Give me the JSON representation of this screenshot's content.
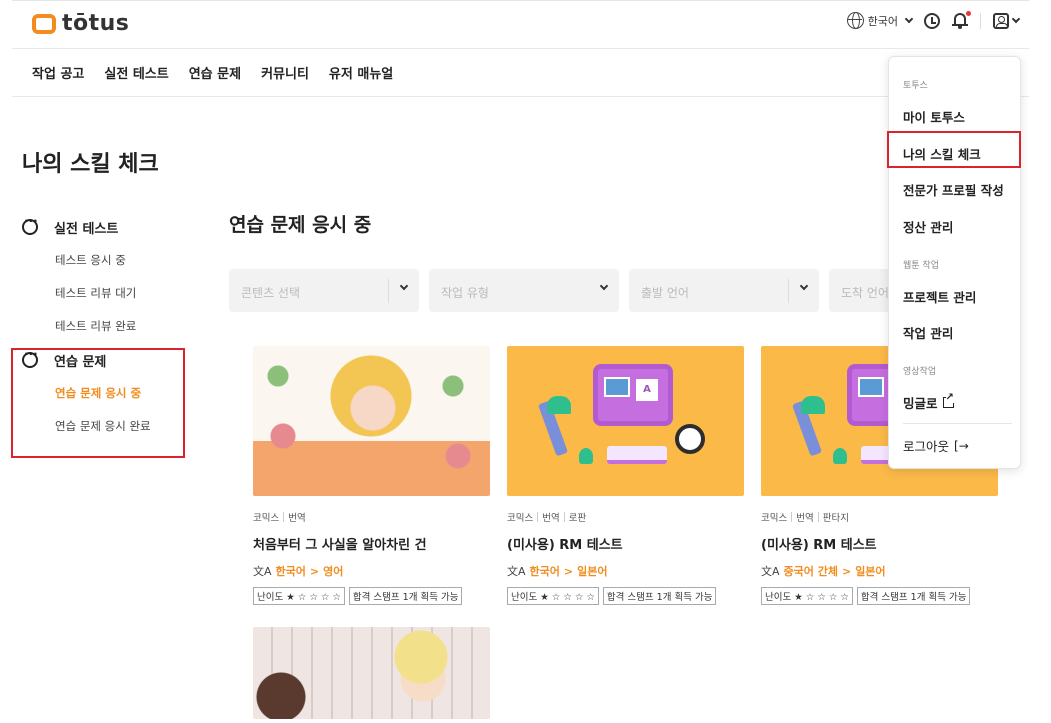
{
  "header": {
    "brand": "tōtus",
    "language": "한국어"
  },
  "nav": [
    "작업 공고",
    "실전 테스트",
    "연습 문제",
    "커뮤니티",
    "유저 매뉴얼"
  ],
  "page_title": "나의 스킬 체크",
  "sidebar": {
    "sections": [
      {
        "title": "실전 테스트",
        "items": [
          {
            "label": "테스트 응시 중",
            "active": false
          },
          {
            "label": "테스트 리뷰 대기",
            "active": false
          },
          {
            "label": "테스트 리뷰 완료",
            "active": false
          }
        ]
      },
      {
        "title": "연습 문제",
        "items": [
          {
            "label": "연습 문제 응시 중",
            "active": true
          },
          {
            "label": "연습 문제 응시 완료",
            "active": false
          }
        ]
      }
    ]
  },
  "content_title": "연습 문제 응시 중",
  "filters": [
    "콘텐츠 선택",
    "작업 유형",
    "출발 언어",
    "도착 언어"
  ],
  "cards": [
    {
      "tags": [
        "코믹스",
        "번역"
      ],
      "title": "처음부터 그 사실을 알아차린 건",
      "source": "한국어",
      "target": "영어",
      "arrow": ">",
      "difficulty": "난이도 ★ ☆ ☆ ☆ ☆",
      "stamp": "합격 스탬프 1개 획득 가능"
    },
    {
      "tags": [
        "코믹스",
        "번역",
        "로판"
      ],
      "title": "(미사용) RM 테스트",
      "source": "한국어",
      "target": "일본어",
      "arrow": ">",
      "difficulty": "난이도 ★ ☆ ☆ ☆ ☆",
      "stamp": "합격 스탬프 1개 획득 가능"
    },
    {
      "tags": [
        "코믹스",
        "번역",
        "판타지"
      ],
      "title": "(미사용) RM 테스트",
      "source": "중국어 간체",
      "target": "일본어",
      "arrow": ">",
      "difficulty": "난이도 ★ ☆ ☆ ☆ ☆",
      "stamp": "합격 스탬프 1개 획득 가능"
    }
  ],
  "illustration_text": "A",
  "dropdown": {
    "section_totus": "토투스",
    "my_totus": "마이 토투스",
    "skill_check": "나의 스킬 체크",
    "expert_profile": "전문가 프로필 작성",
    "settlement": "정산 관리",
    "section_webtoon": "웹툰 작업",
    "project_mgmt": "프로젝트 관리",
    "task_mgmt": "작업 관리",
    "section_video": "영상작업",
    "minglo": "밍글로",
    "logout": "로그아웃"
  },
  "colors": {
    "accent": "#f28c1e",
    "highlight_box": "#d9232d"
  }
}
